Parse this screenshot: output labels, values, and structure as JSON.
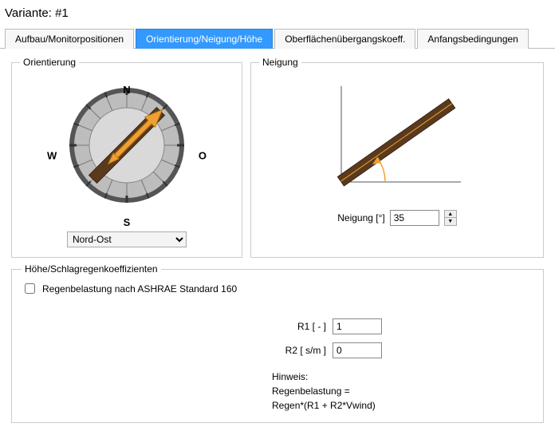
{
  "title": "Variante:  #1",
  "tabs": {
    "t0": "Aufbau/Monitorpositionen",
    "t1": "Orientierung/Neigung/Höhe",
    "t2": "Oberflächenübergangskoeff.",
    "t3": "Anfangsbedingungen",
    "activeIndex": 1
  },
  "orientation": {
    "legend": "Orientierung",
    "labels": {
      "n": "N",
      "s": "S",
      "w": "W",
      "o": "O"
    },
    "selectValue": "Nord-Ost"
  },
  "tilt": {
    "legend": "Neigung",
    "label": "Neigung [°]",
    "value": "35"
  },
  "rain": {
    "legend": "Höhe/Schlagregenkoeffizienten",
    "checkboxLabel": "Regenbelastung nach ASHRAE Standard 160",
    "checked": "false",
    "r1Label": "R1 [ - ]",
    "r1Value": "1",
    "r2Label": "R2 [ s/m ]",
    "r2Value": "0",
    "hintTitle": "Hinweis:",
    "hintLine1": "Regenbelastung =",
    "hintLine2": "Regen*(R1 + R2*Vwind)"
  }
}
